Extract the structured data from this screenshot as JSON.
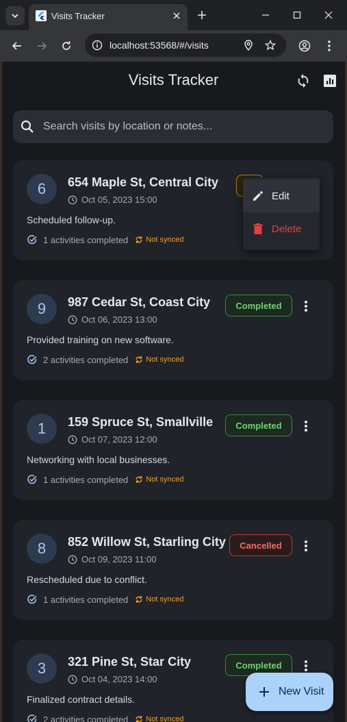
{
  "browser": {
    "tab_title": "Visits Tracker",
    "url": "localhost:53568/#/visits"
  },
  "app": {
    "title": "Visits Tracker",
    "search_placeholder": "Search visits by location or notes...",
    "fab_label": "New Visit"
  },
  "menu": {
    "edit_label": "Edit",
    "delete_label": "Delete"
  },
  "visits": [
    {
      "number": "6",
      "address": "654 Maple St, Central City",
      "date": "Oct 05, 2023 15:00",
      "note": "Scheduled follow-up.",
      "activities": "1 activities completed",
      "sync": "Not synced",
      "status": "",
      "status_type": "pending"
    },
    {
      "number": "9",
      "address": "987 Cedar St, Coast City",
      "date": "Oct 06, 2023 13:00",
      "note": "Provided training on new software.",
      "activities": "2 activities completed",
      "sync": "Not synced",
      "status": "Completed",
      "status_type": "completed"
    },
    {
      "number": "1",
      "address": "159 Spruce St, Smallville",
      "date": "Oct 07, 2023 12:00",
      "note": "Networking with local businesses.",
      "activities": "1 activities completed",
      "sync": "Not synced",
      "status": "Completed",
      "status_type": "completed"
    },
    {
      "number": "8",
      "address": "852 Willow St, Starling City",
      "date": "Oct 09, 2023 11:00",
      "note": "Rescheduled due to conflict.",
      "activities": "1 activities completed",
      "sync": "Not synced",
      "status": "Cancelled",
      "status_type": "cancelled"
    },
    {
      "number": "3",
      "address": "321 Pine St, Star City",
      "date": "Oct 04, 2023 14:00",
      "note": "Finalized contract details.",
      "activities": "2 activities completed",
      "sync": "Not synced",
      "status": "Completed",
      "status_type": "completed"
    }
  ],
  "colors": {
    "accent": "#aad2fb",
    "completed": "#6fd374",
    "cancelled": "#f26b63",
    "not_synced": "#f0a02a",
    "delete": "#e5413b"
  },
  "icons": [
    "search-icon",
    "sync-icon",
    "analytics-icon",
    "clock-icon",
    "check-circle-icon",
    "sync-problem-icon",
    "more-vert-icon",
    "edit-icon",
    "delete-icon",
    "add-icon"
  ]
}
